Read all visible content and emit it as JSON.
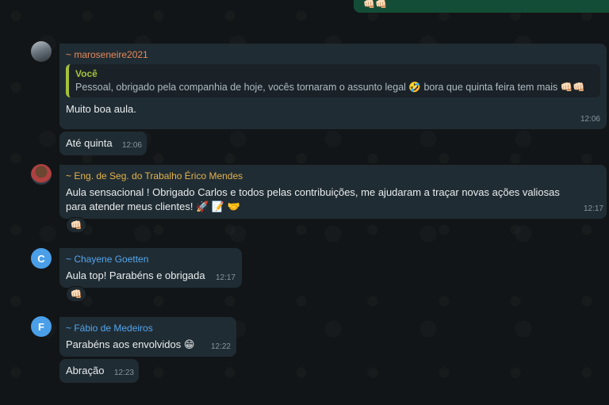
{
  "own_message": {
    "reactions": "👊🏻👊🏻"
  },
  "messages": [
    {
      "sender": "~ maroseneire2021",
      "quote": {
        "author": "Você",
        "text": "Pessoal, obrigado pela companhia de hoje, vocês tornaram o assunto legal 🤣 bora que quinta feira tem mais 👊🏻👊🏻"
      },
      "text": "Muito boa aula.",
      "time": "12:06"
    },
    {
      "text": "Até quinta",
      "time": "12:06"
    },
    {
      "sender": "~ Eng. de Seg. do Trabalho Érico Mendes",
      "text_line1": "Aula sensacional ! Obrigado Carlos e todos pelas contribuições, me ajudaram a traçar novas ações valiosas",
      "text_line2": "para atender meus clientes! 🚀 📝 🤝",
      "time": "12:17",
      "reaction": "👊🏻"
    },
    {
      "avatar_letter": "C",
      "sender": "~ Chayene Goetten",
      "text": "Aula top! Parabéns e obrigada",
      "time": "12:17",
      "reaction": "👊🏻"
    },
    {
      "avatar_letter": "F",
      "sender": "~ Fábio de Medeiros",
      "text": "Parabéns aos envolvidos 😁",
      "time": "12:22"
    },
    {
      "text": "Abração",
      "time": "12:23"
    }
  ],
  "colors": {
    "background": "#111416",
    "incoming_bubble": "#202c33",
    "outgoing_bubble": "#144d37",
    "quote_accent": "#a5c13b"
  }
}
